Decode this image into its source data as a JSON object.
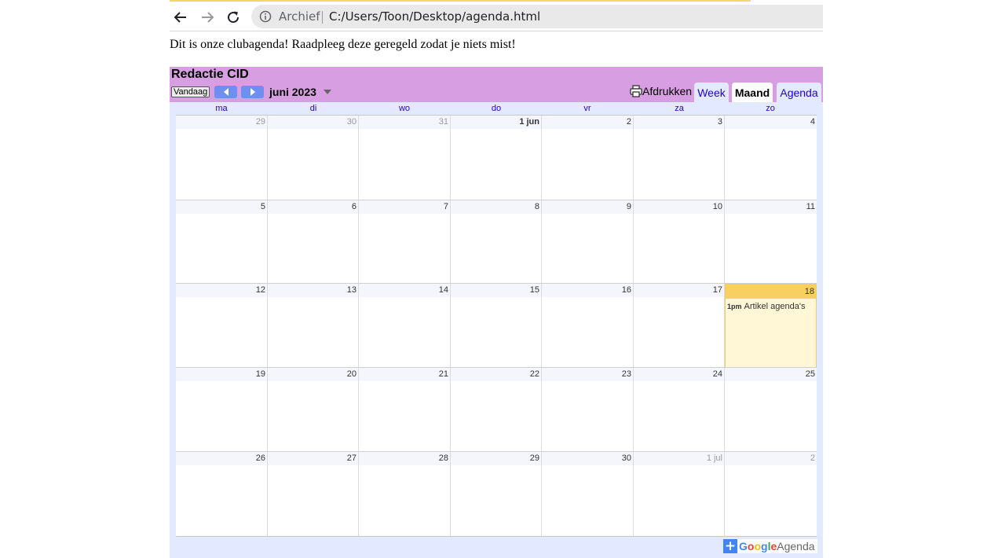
{
  "browser": {
    "omnibox_label": "Archief",
    "url": "C:/Users/Toon/Desktop/agenda.html"
  },
  "page": {
    "intro": "Dit is onze clubagenda! Raadpleeg deze geregeld zodat je niets mist!"
  },
  "calendar": {
    "title": "Redactie CID",
    "today_label": "Vandaag",
    "month_label": "juni 2023",
    "print_label": "Afdrukken",
    "tabs": [
      {
        "label": "Week",
        "active": false
      },
      {
        "label": "Maand",
        "active": true
      },
      {
        "label": "Agenda",
        "active": false
      }
    ],
    "weekdays": [
      "ma",
      "di",
      "wo",
      "do",
      "vr",
      "za",
      "zo"
    ],
    "weeks": [
      [
        "29",
        "30",
        "31",
        "1 jun",
        "2",
        "3",
        "4"
      ],
      [
        "5",
        "6",
        "7",
        "8",
        "9",
        "10",
        "11"
      ],
      [
        "12",
        "13",
        "14",
        "15",
        "16",
        "17",
        "18"
      ],
      [
        "19",
        "20",
        "21",
        "22",
        "23",
        "24",
        "25"
      ],
      [
        "26",
        "27",
        "28",
        "29",
        "30",
        "1 jul",
        "2"
      ]
    ],
    "event": {
      "time": "1pm",
      "title": "Artikel agenda's"
    },
    "footer": {
      "google": "Google",
      "agenda": "Agenda"
    }
  },
  "colors": {
    "header_bg": "#d89ee2",
    "today_bg": "#f8cf60",
    "event_day_bg": "#fff7d6",
    "calendar_bg": "#e3e9ff",
    "link": "#2200cc"
  }
}
